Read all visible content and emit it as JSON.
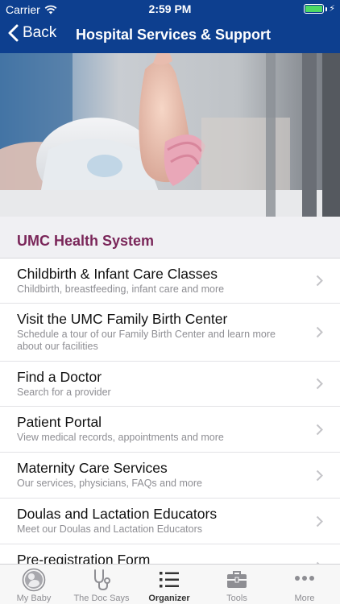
{
  "status_bar": {
    "carrier": "Carrier",
    "time": "2:59 PM",
    "battery_level": 1.0,
    "battery_color": "#4cd964"
  },
  "nav": {
    "back_label": "Back",
    "title": "Hospital Services & Support",
    "bar_color": "#0d3f8f"
  },
  "hero": {
    "icon": "newborn-foot-photo"
  },
  "section": {
    "title": "UMC Health System",
    "title_color": "#7a2659"
  },
  "list": {
    "items": [
      {
        "title": "Childbirth & Infant Care Classes",
        "subtitle": "Childbirth, breastfeeding, infant care and more"
      },
      {
        "title": "Visit the UMC Family Birth Center",
        "subtitle": "Schedule a tour of our Family Birth Center and learn more about our facilities"
      },
      {
        "title": "Find a Doctor",
        "subtitle": "Search for a provider"
      },
      {
        "title": "Patient Portal",
        "subtitle": "View medical records, appointments and more"
      },
      {
        "title": "Maternity Care Services",
        "subtitle": "Our services, physicians, FAQs and more"
      },
      {
        "title": "Doulas and Lactation Educators",
        "subtitle": "Meet our Doulas and Lactation Educators"
      },
      {
        "title": "Pre-registration Form",
        "subtitle": ""
      }
    ]
  },
  "tabbar": {
    "tabs": [
      {
        "label": "My Baby",
        "icon": "baby-icon"
      },
      {
        "label": "The Doc Says",
        "icon": "stethoscope-icon"
      },
      {
        "label": "Organizer",
        "icon": "list-icon"
      },
      {
        "label": "Tools",
        "icon": "toolbox-icon"
      },
      {
        "label": "More",
        "icon": "more-dots-icon"
      }
    ],
    "active_tab": "Organizer"
  }
}
